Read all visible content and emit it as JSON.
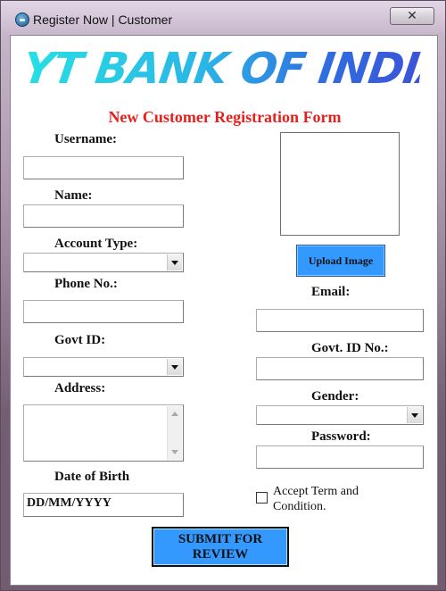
{
  "window": {
    "title": "Register Now | Customer",
    "close_glyph": "✕"
  },
  "banner": {
    "text": "YT BANK OF INDIA"
  },
  "form": {
    "title": "New Customer Registration Form",
    "username_label": "Username:",
    "username_value": "",
    "name_label": "Name:",
    "name_value": "",
    "account_type_label": "Account Type:",
    "account_type_value": "",
    "phone_label": "Phone No.:",
    "phone_value": "",
    "govt_id_label": "Govt ID:",
    "govt_id_value": "",
    "address_label": "Address:",
    "address_value": "",
    "dob_label": "Date of Birth",
    "dob_value": "DD/MM/YYYY",
    "email_label": "Email:",
    "email_value": "",
    "govt_id_no_label": "Govt. ID No.:",
    "govt_id_no_value": "",
    "gender_label": "Gender:",
    "gender_value": "",
    "password_label": "Password:",
    "password_value": "",
    "upload_button": "Upload Image",
    "accept_terms_label_line1": "Accept Term and",
    "accept_terms_label_line2": "Condition.",
    "accept_terms_checked": false,
    "submit_line1": "SUBMIT FOR",
    "submit_line2": "REVIEW"
  },
  "colors": {
    "form_title": "#e6201d",
    "button_fill": "#3399ff",
    "banner_start": "#26e0e3",
    "banner_end": "#3c52d8"
  },
  "icons": {
    "app": "app-icon",
    "close": "close-icon",
    "dropdown": "chevron-down-icon"
  }
}
